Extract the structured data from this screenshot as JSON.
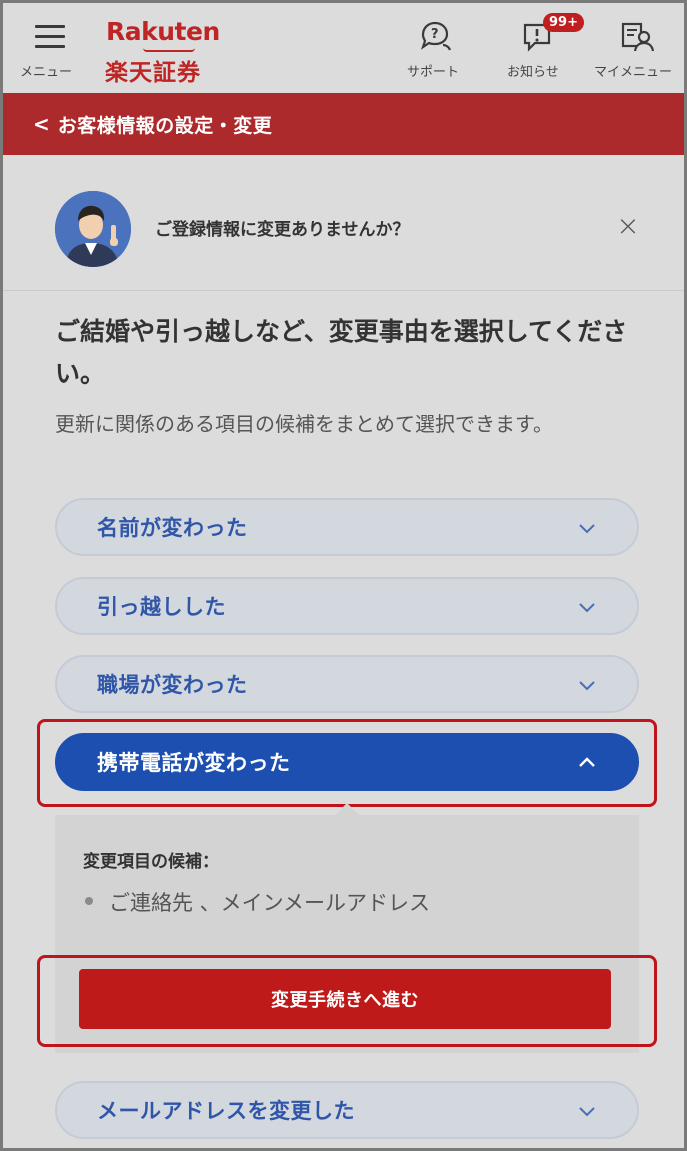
{
  "header": {
    "menu_label": "メニュー",
    "logo_en": "Rakuten",
    "logo_jp": "楽天証券",
    "support_label": "サポート",
    "notice_label": "お知らせ",
    "notice_badge": "99+",
    "mymenu_label": "マイメニュー"
  },
  "titlebar": {
    "back_glyph": "<",
    "title": "お客様情報の設定・変更"
  },
  "prompt": {
    "question": "ご登録情報に変更ありませんか？",
    "close_glyph": "×"
  },
  "main": {
    "heading": "ご結婚や引っ越しなど、変更事由を選択してください。",
    "subtext": "更新に関係のある項目の候補をまとめて選択できます。"
  },
  "reasons": [
    {
      "label": "名前が変わった",
      "expanded": false
    },
    {
      "label": "引っ越しした",
      "expanded": false
    },
    {
      "label": "職場が変わった",
      "expanded": false
    },
    {
      "label": "携帯電話が変わった",
      "expanded": true
    },
    {
      "label": "メールアドレスを変更した",
      "expanded": false
    }
  ],
  "panel": {
    "title": "変更項目の候補：",
    "items": [
      "ご連絡先 、メインメールアドレス"
    ],
    "proceed_label": "変更手続きへ進む"
  },
  "colors": {
    "brand_red": "#bf2525",
    "active_blue": "#1c4fb0",
    "label_blue": "#2f56a8"
  }
}
